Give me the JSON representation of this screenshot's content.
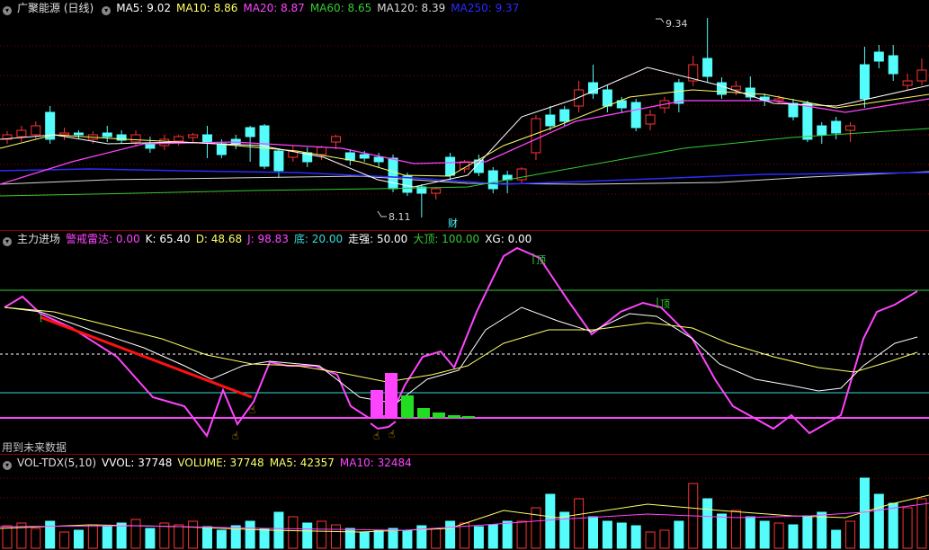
{
  "price_pane": {
    "title": "广聚能源 (日线)",
    "indicators": [
      {
        "label": "MA5: 9.02",
        "color": "#ffffff"
      },
      {
        "label": "MA10: 8.86",
        "color": "#ffff66"
      },
      {
        "label": "MA20: 8.87",
        "color": "#ff44ff"
      },
      {
        "label": "MA60: 8.65",
        "color": "#33cc33"
      },
      {
        "label": "MA120: 8.39",
        "color": "#d8d8d8"
      },
      {
        "label": "MA250: 9.37",
        "color": "#2b2bff"
      }
    ],
    "high_label": "9.34",
    "low_label": "8.11",
    "finance_marker": "财"
  },
  "kdj_pane": {
    "title": "主力进场",
    "indicators": [
      {
        "label": "警戒雷达: 0.00",
        "color": "#ff44ff"
      },
      {
        "label": "K: 65.40",
        "color": "#ffffff"
      },
      {
        "label": "D: 48.68",
        "color": "#ffff66"
      },
      {
        "label": "J: 98.83",
        "color": "#ff44ff"
      },
      {
        "label": "底: 20.00",
        "color": "#33dddd"
      },
      {
        "label": "走强: 50.00",
        "color": "#ffffff"
      },
      {
        "label": "大顶: 100.00",
        "color": "#33cc33"
      },
      {
        "label": "XG: 0.00",
        "color": "#ffffff"
      }
    ],
    "top_marker": "顶",
    "future_data_note": "用到未来数据"
  },
  "volume_pane": {
    "title": "VOL-TDX(5,10)",
    "indicators": [
      {
        "label": "VVOL: 37748",
        "color": "#ffffff"
      },
      {
        "label": "VOLUME: 37748",
        "color": "#ffff66"
      },
      {
        "label": "MA5: 42357",
        "color": "#ffff66"
      },
      {
        "label": "MA10: 32484",
        "color": "#ff44ff"
      }
    ]
  },
  "colors": {
    "up": "#ff3333",
    "down": "#54fcfc",
    "grid": "#8b0000",
    "background": "#000000"
  }
}
